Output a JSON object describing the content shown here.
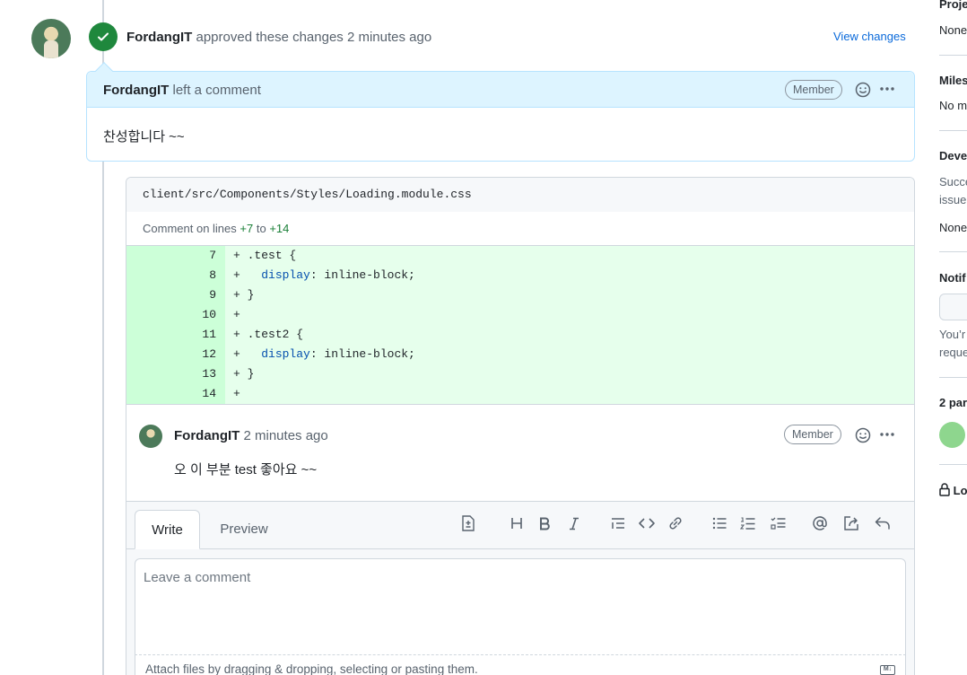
{
  "review": {
    "author": "FordangIT",
    "action": "approved these changes",
    "time": "2 minutes ago",
    "view_changes": "View changes"
  },
  "review_comment": {
    "author": "FordangIT",
    "action": "left a comment",
    "badge": "Member",
    "body": "찬성합니다 ~~"
  },
  "thread": {
    "file_path": "client/src/Components/Styles/Loading.module.css",
    "lines_prefix": "Comment on lines",
    "line_from": "+7",
    "lines_mid": "to",
    "line_to": "+14",
    "diff": [
      {
        "num": "7",
        "sign": "+",
        "code": ".test {"
      },
      {
        "num": "8",
        "sign": "+",
        "code": "  display: inline-block;"
      },
      {
        "num": "9",
        "sign": "+",
        "code": "}"
      },
      {
        "num": "10",
        "sign": "+",
        "code": ""
      },
      {
        "num": "11",
        "sign": "+",
        "code": ".test2 {"
      },
      {
        "num": "12",
        "sign": "+",
        "code": "  display: inline-block;"
      },
      {
        "num": "13",
        "sign": "+",
        "code": "}"
      },
      {
        "num": "14",
        "sign": "+",
        "code": ""
      }
    ],
    "comment": {
      "author": "FordangIT",
      "time": "2 minutes ago",
      "badge": "Member",
      "body": "오 이 부분 test 좋아요 ~~"
    }
  },
  "editor": {
    "tab_write": "Write",
    "tab_preview": "Preview",
    "placeholder": "Leave a comment",
    "attach_hint": "Attach files by dragging & dropping, selecting or pasting them.",
    "md_badge": "M↓",
    "toolbar_icons": [
      "template-icon",
      "heading-icon",
      "bold-icon",
      "italic-icon",
      "quote-icon",
      "code-icon",
      "link-icon",
      "unordered-list-icon",
      "ordered-list-icon",
      "task-list-icon",
      "mention-icon",
      "cross-reference-icon",
      "reply-icon"
    ]
  },
  "sidebar": {
    "projects": "Proje",
    "projects_value": "None",
    "milestone": "Miles",
    "milestone_value": "No m",
    "development": "Deve",
    "development_text_1": "Succe",
    "development_text_2": "issue",
    "development_value": "None",
    "notifications": "Notif",
    "notif_text_1": "You’r",
    "notif_text_2": "reque",
    "participants": "2 par",
    "lock": "Lo"
  },
  "colors": {
    "approve_green": "#1f883d",
    "link_blue": "#0969da",
    "diff_add_bg": "#e6ffec",
    "diff_add_num_bg": "#ccffd8",
    "review_header_bg": "#ddf4ff"
  }
}
